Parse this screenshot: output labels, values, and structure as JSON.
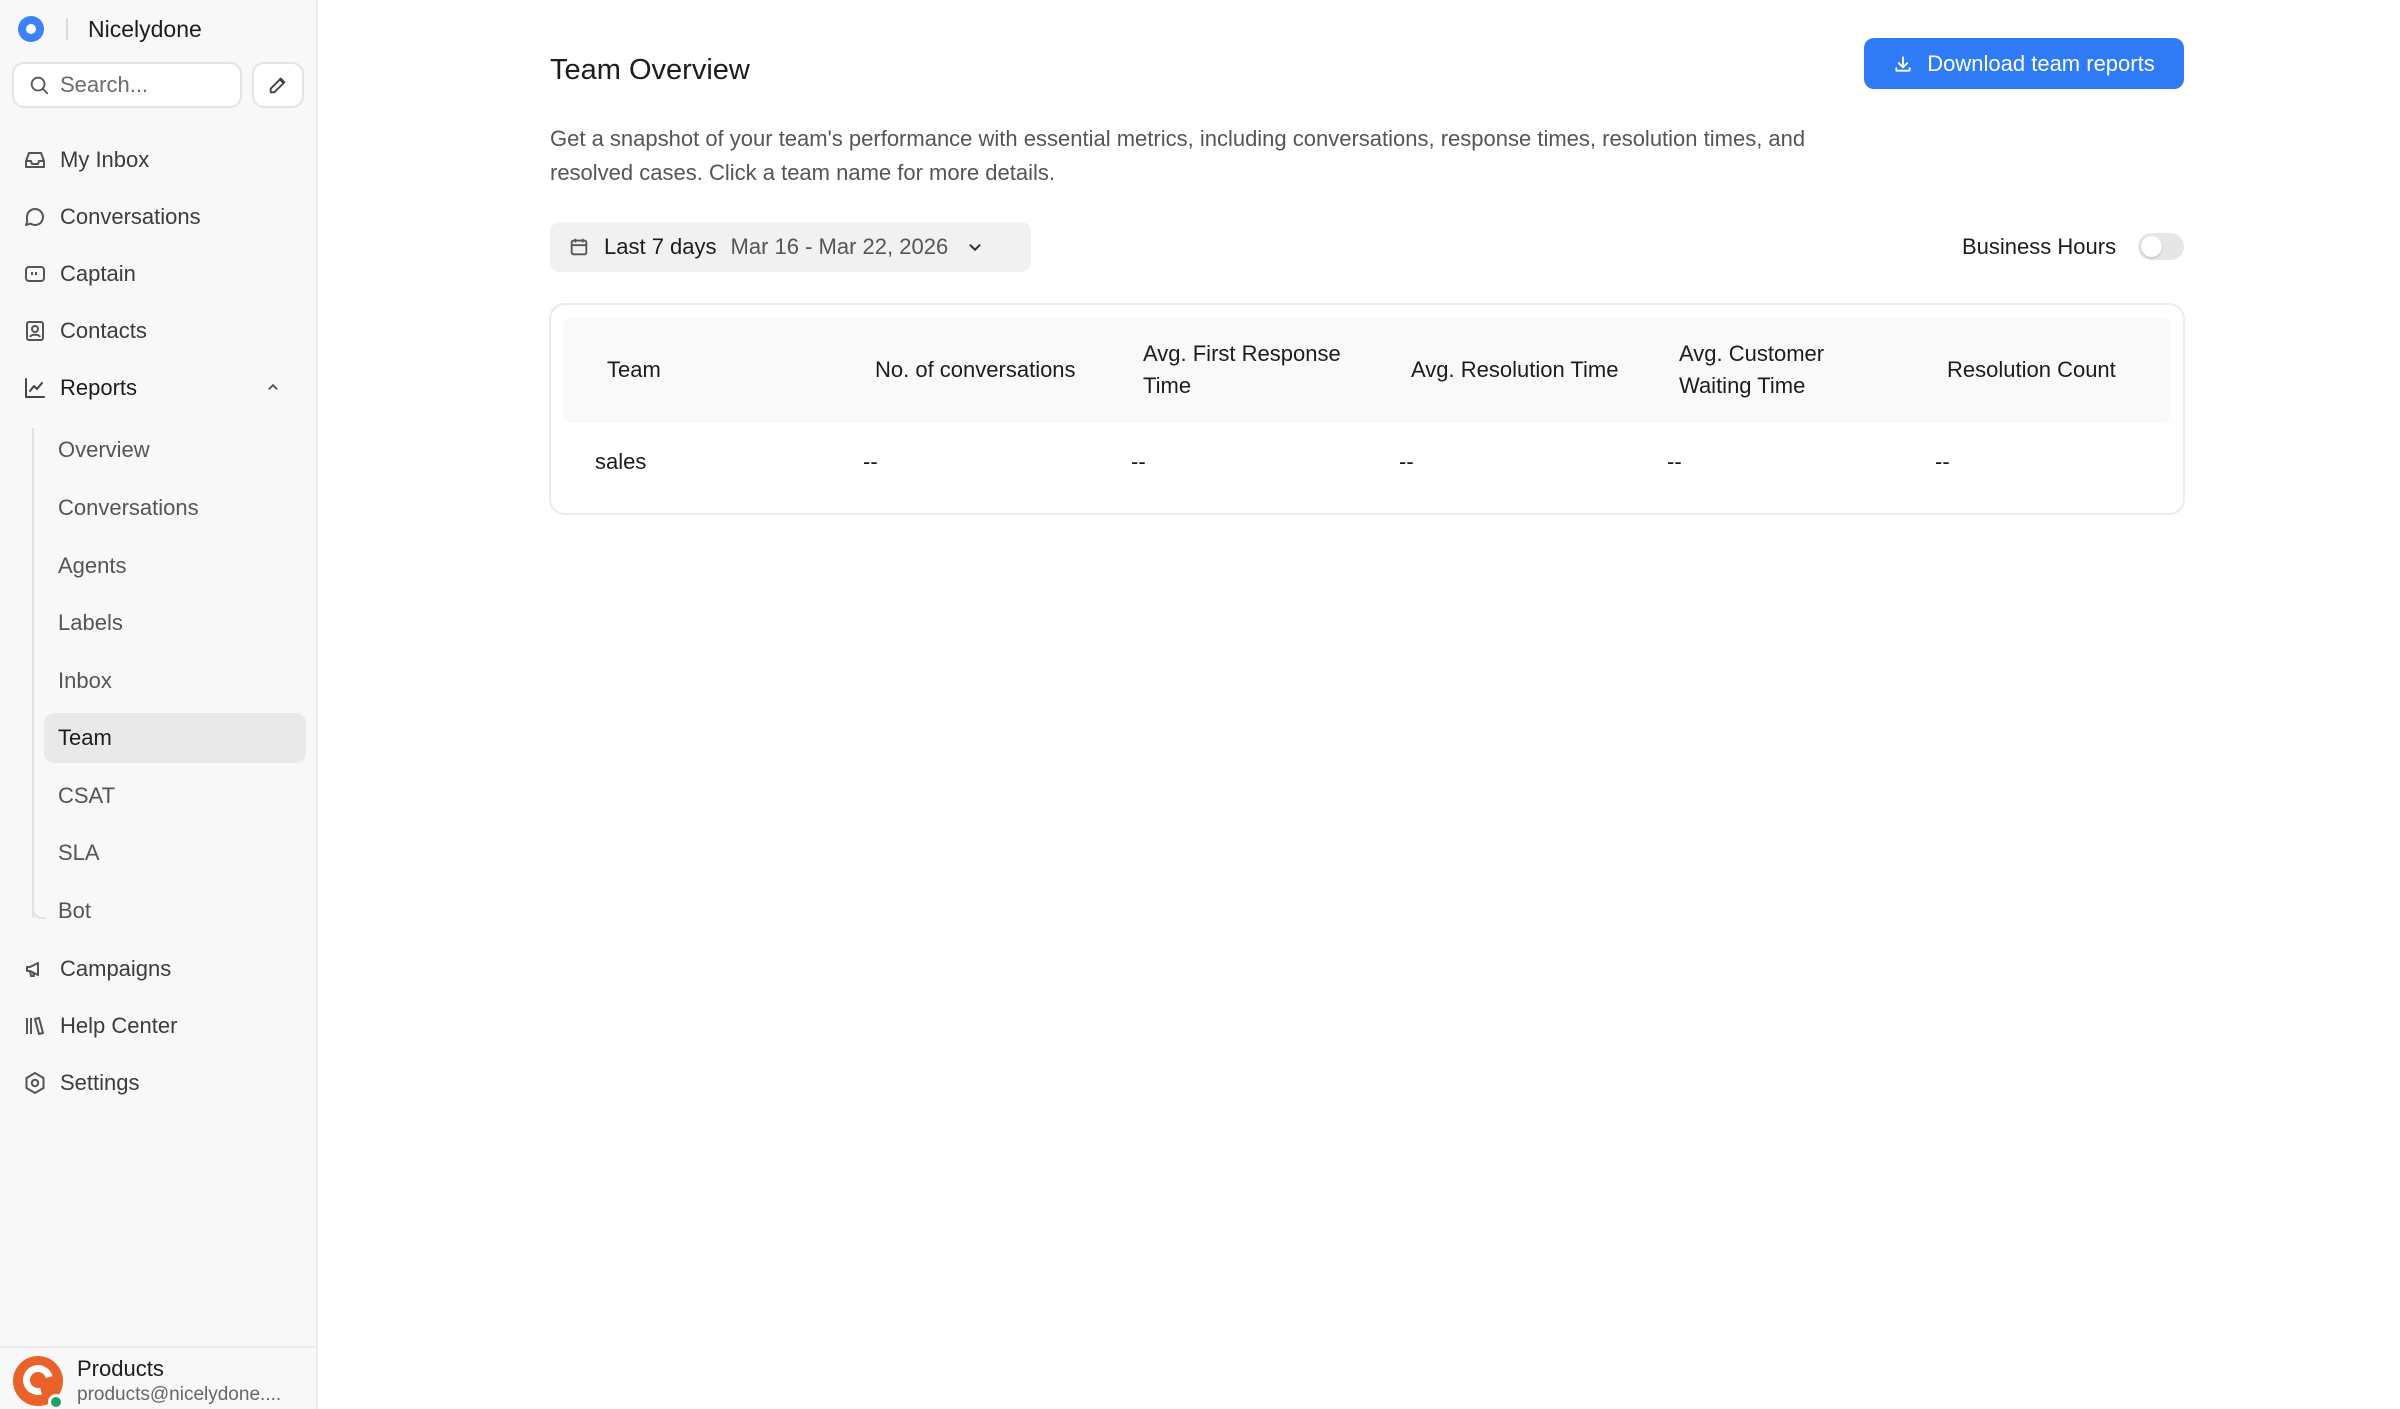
{
  "brand": {
    "name": "Nicelydone",
    "accent": "#3b82f6"
  },
  "search": {
    "placeholder": "Search..."
  },
  "sidebar": {
    "items": [
      {
        "label": "My Inbox",
        "icon": "inbox-icon"
      },
      {
        "label": "Conversations",
        "icon": "chat-bubble-icon"
      },
      {
        "label": "Captain",
        "icon": "captain-icon"
      },
      {
        "label": "Contacts",
        "icon": "contacts-icon"
      },
      {
        "label": "Reports",
        "icon": "chart-icon",
        "expanded": true
      },
      {
        "label": "Campaigns",
        "icon": "megaphone-icon"
      },
      {
        "label": "Help Center",
        "icon": "library-icon"
      },
      {
        "label": "Settings",
        "icon": "gear-icon"
      }
    ],
    "reports_sub": [
      "Overview",
      "Conversations",
      "Agents",
      "Labels",
      "Inbox",
      "Team",
      "CSAT",
      "SLA",
      "Bot"
    ],
    "active_sub": "Team"
  },
  "user": {
    "name": "Products",
    "email": "products@nicelydone...."
  },
  "header": {
    "title": "Team Overview",
    "download_label": "Download team reports",
    "description": "Get a snapshot of your team's performance with essential metrics, including conversations, response times, resolution times, and resolved cases. Click a team name for more details."
  },
  "filters": {
    "range_name": "Last 7 days",
    "range": "Mar 16 - Mar 22, 2026",
    "business_hours_label": "Business Hours",
    "business_hours_on": false
  },
  "table": {
    "columns": [
      "Team",
      "No. of conversations",
      "Avg. First Response Time",
      "Avg. Resolution Time",
      "Avg. Customer Waiting Time",
      "Resolution Count"
    ],
    "rows": [
      [
        "sales",
        "--",
        "--",
        "--",
        "--",
        "--"
      ]
    ]
  },
  "colors": {
    "primary_button": "#2f7bf5",
    "sidebar_bg": "#f8f8f8",
    "status_online": "#22a06b"
  }
}
